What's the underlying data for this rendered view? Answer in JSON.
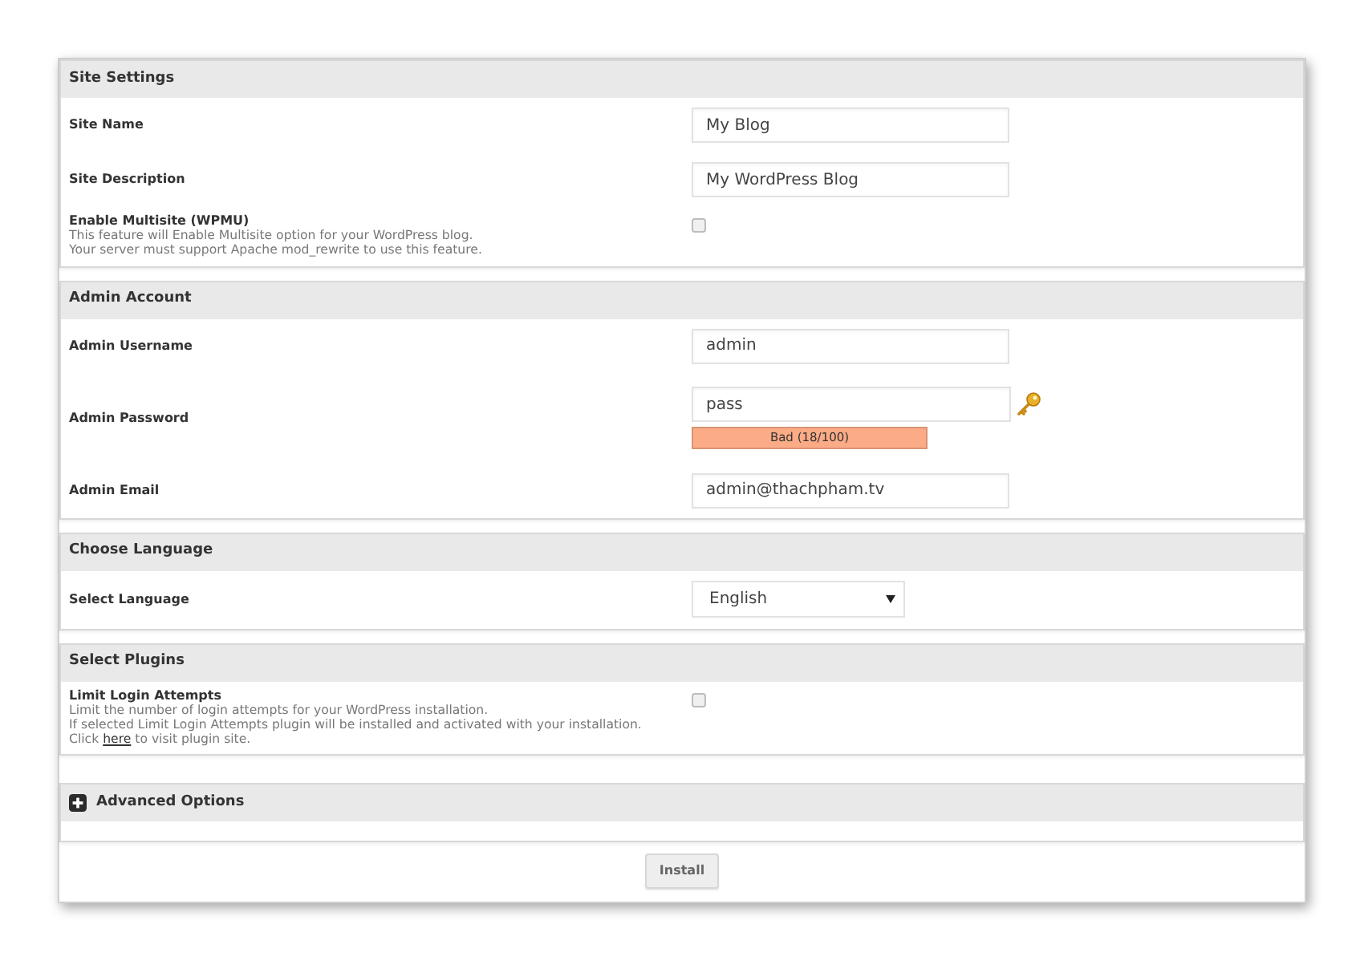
{
  "sections": [
    {
      "title": "Site Settings",
      "fields": [
        {
          "kind": "text",
          "label": "Site Name",
          "value": "My Blog"
        },
        {
          "kind": "text",
          "label": "Site Description",
          "value": "My WordPress Blog"
        },
        {
          "kind": "checkbox",
          "label": "Enable Multisite (WPMU)",
          "description": [
            "This feature will Enable Multisite option for your WordPress blog.",
            "Your server must support Apache mod_rewrite to use this feature."
          ],
          "checked": false
        }
      ]
    },
    {
      "title": "Admin Account",
      "fields": [
        {
          "kind": "text",
          "label": "Admin Username",
          "value": "admin"
        },
        {
          "kind": "password",
          "label": "Admin Password",
          "value": "pass",
          "strength": {
            "color": "#fbab86",
            "label": "Bad (18/100)"
          }
        },
        {
          "kind": "text",
          "label": "Admin Email",
          "value": "admin@thachpham.tv"
        }
      ]
    },
    {
      "title": "Choose Language",
      "fields": [
        {
          "kind": "select",
          "label": "Select Language",
          "value": "English"
        }
      ]
    },
    {
      "title": "Select Plugins",
      "fields": [
        {
          "kind": "checkbox",
          "label": "Limit Login Attempts",
          "description": [
            "Limit the number of login attempts for your WordPress installation.",
            "If selected Limit Login Attempts plugin will be installed and activated with your installation."
          ],
          "link_line": {
            "before": "Click",
            "link": "here",
            "after": "to visit plugin site."
          },
          "checked": false
        }
      ]
    }
  ],
  "advanced_options": {
    "title": "Advanced Options",
    "expanded": false
  },
  "install_button": {
    "label": "Install"
  }
}
